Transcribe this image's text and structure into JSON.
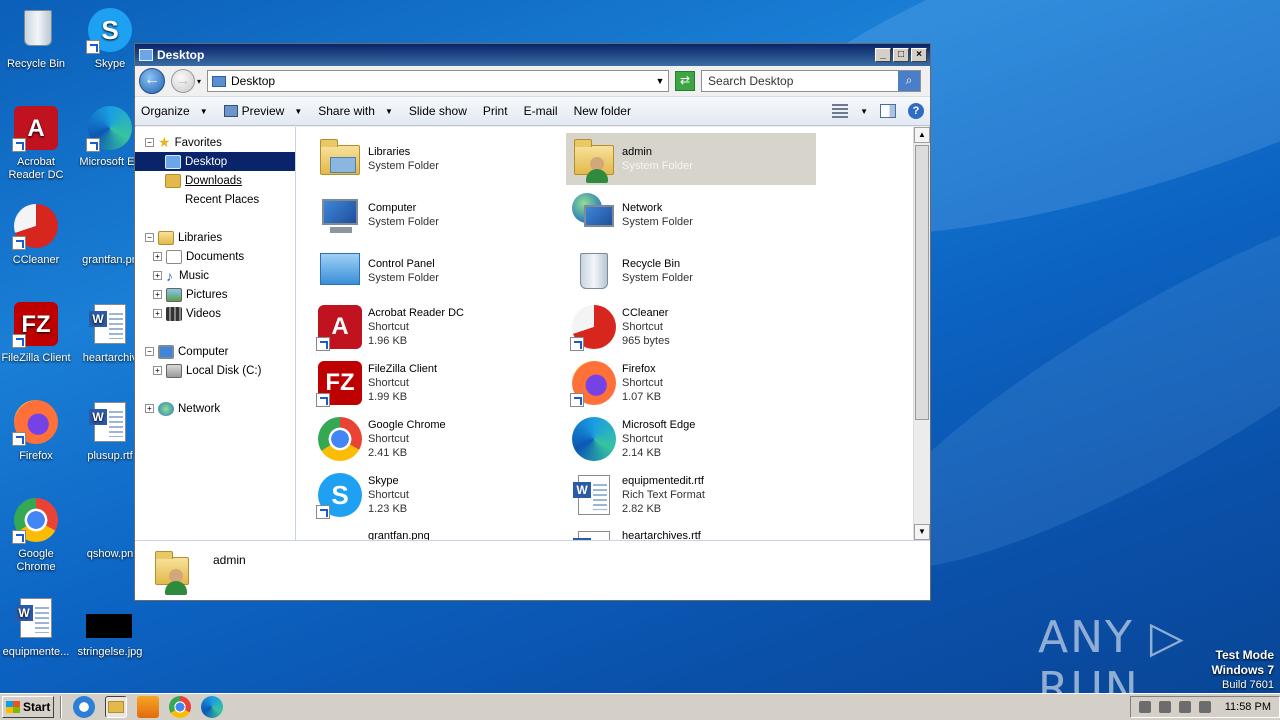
{
  "desktop": {
    "icons": [
      {
        "label": "Recycle Bin"
      },
      {
        "label": "Skype"
      },
      {
        "label": "Acrobat Reader DC"
      },
      {
        "label": "Microsoft Ed"
      },
      {
        "label": "CCleaner"
      },
      {
        "label": "grantfan.pn"
      },
      {
        "label": "FileZilla Client"
      },
      {
        "label": "heartarchiv"
      },
      {
        "label": "Firefox"
      },
      {
        "label": "plusup.rtf"
      },
      {
        "label": "Google Chrome"
      },
      {
        "label": "qshow.pn"
      },
      {
        "label": "equipmente..."
      },
      {
        "label": "stringelse.jpg"
      }
    ],
    "watermark": "ANY ▷ RUN",
    "testmode": {
      "line1": "Test Mode",
      "line2": "Windows 7",
      "line3": "Build 7601"
    }
  },
  "window": {
    "title": "Desktop",
    "address": "Desktop",
    "search_placeholder": "Search Desktop",
    "toolbar": {
      "organize": "Organize",
      "preview": "Preview",
      "share_with": "Share with",
      "slide_show": "Slide show",
      "print": "Print",
      "email": "E-mail",
      "new_folder": "New folder"
    },
    "nav": {
      "favorites": "Favorites",
      "desktop": "Desktop",
      "downloads": "Downloads",
      "recent_places": "Recent Places",
      "libraries": "Libraries",
      "documents": "Documents",
      "music": "Music",
      "pictures": "Pictures",
      "videos": "Videos",
      "computer": "Computer",
      "local_disk": "Local Disk (C:)",
      "network": "Network"
    },
    "items": [
      {
        "name": "Libraries",
        "type": "System Folder",
        "size": ""
      },
      {
        "name": "admin",
        "type": "System Folder",
        "size": ""
      },
      {
        "name": "Computer",
        "type": "System Folder",
        "size": ""
      },
      {
        "name": "Network",
        "type": "System Folder",
        "size": ""
      },
      {
        "name": "Control Panel",
        "type": "System Folder",
        "size": ""
      },
      {
        "name": "Recycle Bin",
        "type": "System Folder",
        "size": ""
      },
      {
        "name": "Acrobat Reader DC",
        "type": "Shortcut",
        "size": "1.96 KB"
      },
      {
        "name": "CCleaner",
        "type": "Shortcut",
        "size": "965 bytes"
      },
      {
        "name": "FileZilla Client",
        "type": "Shortcut",
        "size": "1.99 KB"
      },
      {
        "name": "Firefox",
        "type": "Shortcut",
        "size": "1.07 KB"
      },
      {
        "name": "Google Chrome",
        "type": "Shortcut",
        "size": "2.41 KB"
      },
      {
        "name": "Microsoft Edge",
        "type": "Shortcut",
        "size": "2.14 KB"
      },
      {
        "name": "Skype",
        "type": "Shortcut",
        "size": "1.23 KB"
      },
      {
        "name": "equipmentedit.rtf",
        "type": "Rich Text Format",
        "size": "2.82 KB"
      },
      {
        "name": "grantfan.png",
        "type": "",
        "size": ""
      },
      {
        "name": "heartarchives.rtf",
        "type": "",
        "size": ""
      }
    ],
    "details": {
      "name": "admin"
    }
  },
  "taskbar": {
    "start": "Start",
    "clock": "11:58 PM"
  }
}
